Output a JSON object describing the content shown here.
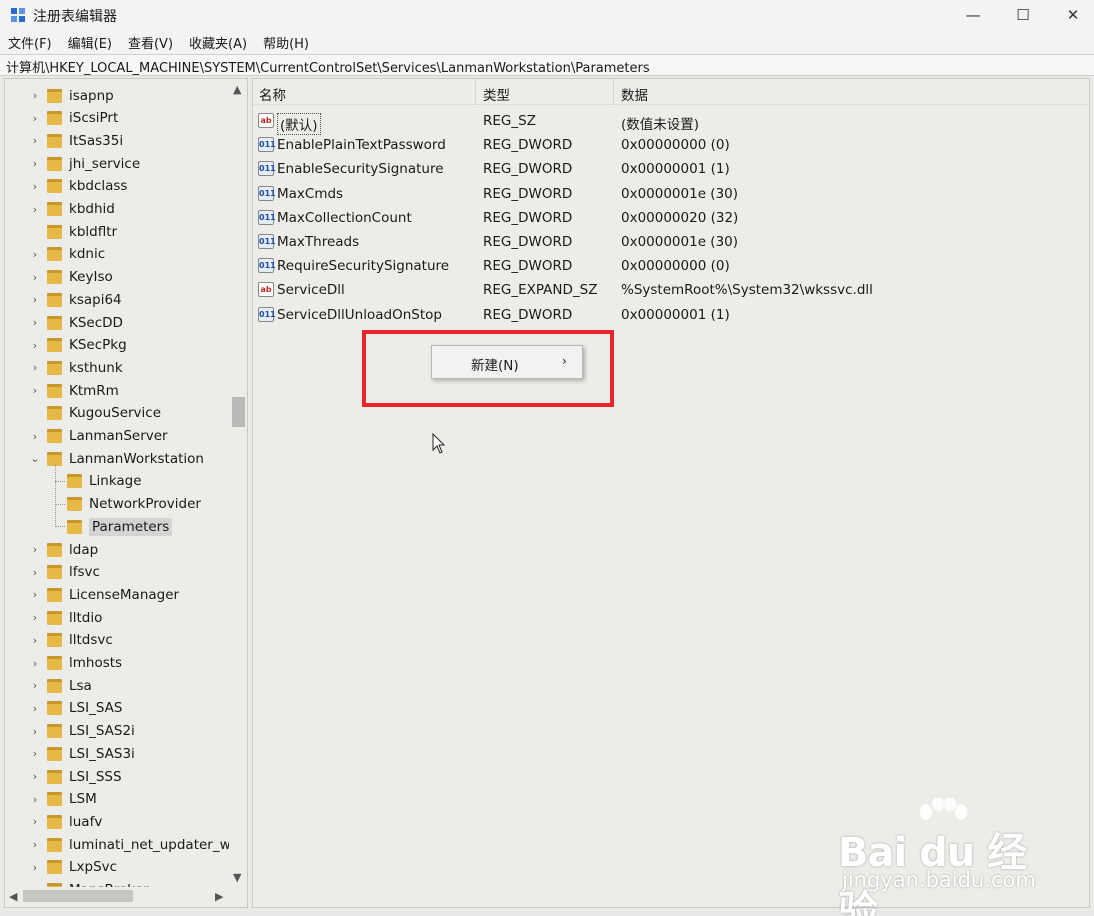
{
  "window": {
    "title": "注册表编辑器",
    "minimize": "—",
    "maximize": "☐",
    "close": "✕"
  },
  "menu": [
    "文件(F)",
    "编辑(E)",
    "查看(V)",
    "收藏夹(A)",
    "帮助(H)"
  ],
  "address": "计算机\\HKEY_LOCAL_MACHINE\\SYSTEM\\CurrentControlSet\\Services\\LanmanWorkstation\\Parameters",
  "tree": {
    "items": [
      {
        "label": "isapnp",
        "level": 0,
        "expander": "collapsed"
      },
      {
        "label": "iScsiPrt",
        "level": 0,
        "expander": "collapsed"
      },
      {
        "label": "ItSas35i",
        "level": 0,
        "expander": "collapsed"
      },
      {
        "label": "jhi_service",
        "level": 0,
        "expander": "collapsed"
      },
      {
        "label": "kbdclass",
        "level": 0,
        "expander": "collapsed"
      },
      {
        "label": "kbdhid",
        "level": 0,
        "expander": "collapsed"
      },
      {
        "label": "kbldfltr",
        "level": 0,
        "expander": "none"
      },
      {
        "label": "kdnic",
        "level": 0,
        "expander": "collapsed"
      },
      {
        "label": "KeyIso",
        "level": 0,
        "expander": "collapsed"
      },
      {
        "label": "ksapi64",
        "level": 0,
        "expander": "collapsed"
      },
      {
        "label": "KSecDD",
        "level": 0,
        "expander": "collapsed"
      },
      {
        "label": "KSecPkg",
        "level": 0,
        "expander": "collapsed"
      },
      {
        "label": "ksthunk",
        "level": 0,
        "expander": "collapsed"
      },
      {
        "label": "KtmRm",
        "level": 0,
        "expander": "collapsed"
      },
      {
        "label": "KugouService",
        "level": 0,
        "expander": "none"
      },
      {
        "label": "LanmanServer",
        "level": 0,
        "expander": "collapsed"
      },
      {
        "label": "LanmanWorkstation",
        "level": 0,
        "expander": "expanded"
      },
      {
        "label": "Linkage",
        "level": 1,
        "expander": "none"
      },
      {
        "label": "NetworkProvider",
        "level": 1,
        "expander": "none"
      },
      {
        "label": "Parameters",
        "level": 1,
        "expander": "none",
        "selected": true
      },
      {
        "label": "ldap",
        "level": 0,
        "expander": "collapsed"
      },
      {
        "label": "lfsvc",
        "level": 0,
        "expander": "collapsed"
      },
      {
        "label": "LicenseManager",
        "level": 0,
        "expander": "collapsed"
      },
      {
        "label": "lltdio",
        "level": 0,
        "expander": "collapsed"
      },
      {
        "label": "lltdsvc",
        "level": 0,
        "expander": "collapsed"
      },
      {
        "label": "lmhosts",
        "level": 0,
        "expander": "collapsed"
      },
      {
        "label": "Lsa",
        "level": 0,
        "expander": "collapsed"
      },
      {
        "label": "LSI_SAS",
        "level": 0,
        "expander": "collapsed"
      },
      {
        "label": "LSI_SAS2i",
        "level": 0,
        "expander": "collapsed"
      },
      {
        "label": "LSI_SAS3i",
        "level": 0,
        "expander": "collapsed"
      },
      {
        "label": "LSI_SSS",
        "level": 0,
        "expander": "collapsed"
      },
      {
        "label": "LSM",
        "level": 0,
        "expander": "collapsed"
      },
      {
        "label": "luafv",
        "level": 0,
        "expander": "collapsed"
      },
      {
        "label": "luminati_net_updater_wi",
        "level": 0,
        "expander": "collapsed"
      },
      {
        "label": "LxpSvc",
        "level": 0,
        "expander": "collapsed"
      },
      {
        "label": "MapsBroker",
        "level": 0,
        "expander": "collapsed"
      }
    ],
    "scroll_up": "▲",
    "scroll_down": "▼",
    "scroll_left": "◀",
    "scroll_right": "▶"
  },
  "list": {
    "headers": {
      "name": "名称",
      "type": "类型",
      "data": "数据"
    },
    "rows": [
      {
        "icon": "ab",
        "name": "(默认)",
        "type": "REG_SZ",
        "data": "(数值未设置)",
        "is_default": true
      },
      {
        "icon": "dw",
        "name": "EnablePlainTextPassword",
        "type": "REG_DWORD",
        "data": "0x00000000 (0)"
      },
      {
        "icon": "dw",
        "name": "EnableSecuritySignature",
        "type": "REG_DWORD",
        "data": "0x00000001 (1)"
      },
      {
        "icon": "dw",
        "name": "MaxCmds",
        "type": "REG_DWORD",
        "data": "0x0000001e (30)"
      },
      {
        "icon": "dw",
        "name": "MaxCollectionCount",
        "type": "REG_DWORD",
        "data": "0x00000020 (32)"
      },
      {
        "icon": "dw",
        "name": "MaxThreads",
        "type": "REG_DWORD",
        "data": "0x0000001e (30)"
      },
      {
        "icon": "dw",
        "name": "RequireSecuritySignature",
        "type": "REG_DWORD",
        "data": "0x00000000 (0)"
      },
      {
        "icon": "ab",
        "name": "ServiceDll",
        "type": "REG_EXPAND_SZ",
        "data": "%SystemRoot%\\System32\\wkssvc.dll"
      },
      {
        "icon": "dw",
        "name": "ServiceDllUnloadOnStop",
        "type": "REG_DWORD",
        "data": "0x00000001 (1)"
      }
    ],
    "icon_text": {
      "ab": "ab",
      "dw": "011"
    }
  },
  "context_menu": {
    "new_label": "新建(N)",
    "submenu_arrow": "›"
  },
  "colors": {
    "highlight_border": "#e8242d",
    "folder": "#e6b846"
  },
  "watermark": {
    "logo": "Bai du 经验",
    "site": "jingyan.baidu.com"
  }
}
